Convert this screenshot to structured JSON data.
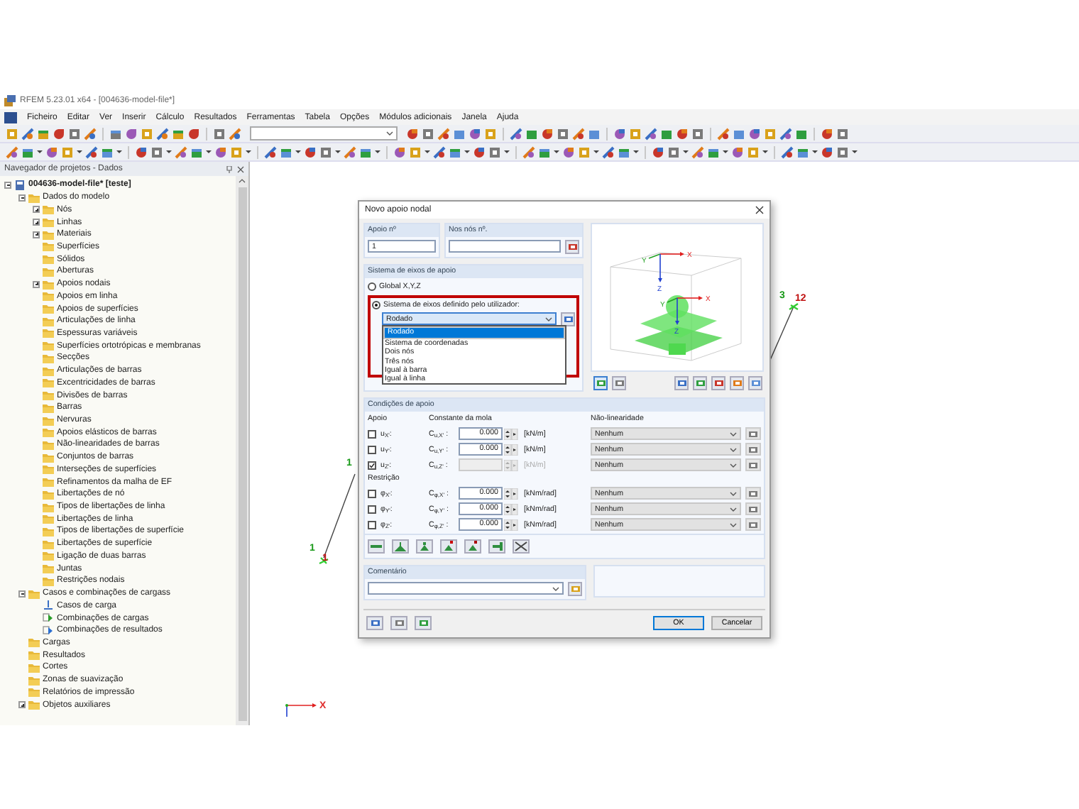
{
  "window": {
    "title": "RFEM 5.23.01 x64 - [004636-model-file*]"
  },
  "menu": [
    {
      "label": "Ficheiro"
    },
    {
      "label": "Editar"
    },
    {
      "label": "Ver"
    },
    {
      "label": "Inserir"
    },
    {
      "label": "Cálculo"
    },
    {
      "label": "Resultados"
    },
    {
      "label": "Ferramentas"
    },
    {
      "label": "Tabela"
    },
    {
      "label": "Opções"
    },
    {
      "label": "Módulos adicionais"
    },
    {
      "label": "Janela"
    },
    {
      "label": "Ajuda"
    }
  ],
  "navigator": {
    "title": "Navegador de projetos - Dados",
    "tree": [
      {
        "label": "004636-model-file* [teste]",
        "expanded": true,
        "children": [
          {
            "label": "Dados do modelo",
            "expanded": true,
            "children": [
              {
                "label": "Nós",
                "expanded": false
              },
              {
                "label": "Linhas",
                "expanded": false
              },
              {
                "label": "Materiais",
                "expanded": false
              },
              {
                "label": "Superfícies"
              },
              {
                "label": "Sólidos"
              },
              {
                "label": "Aberturas"
              },
              {
                "label": "Apoios nodais",
                "expanded": false
              },
              {
                "label": "Apoios em linha"
              },
              {
                "label": "Apoios de superfícies"
              },
              {
                "label": "Articulações de linha"
              },
              {
                "label": "Espessuras variáveis"
              },
              {
                "label": "Superfícies ortotrópicas e membranas"
              },
              {
                "label": "Secções"
              },
              {
                "label": "Articulações de barras"
              },
              {
                "label": "Excentricidades de barras"
              },
              {
                "label": "Divisões de barras"
              },
              {
                "label": "Barras"
              },
              {
                "label": "Nervuras"
              },
              {
                "label": "Apoios elásticos de barras"
              },
              {
                "label": "Não-linearidades de barras"
              },
              {
                "label": "Conjuntos de barras"
              },
              {
                "label": "Interseções de superfícies"
              },
              {
                "label": "Refinamentos da malha de EF"
              },
              {
                "label": "Libertações de nó"
              },
              {
                "label": "Tipos de libertações de linha"
              },
              {
                "label": "Libertações de linha"
              },
              {
                "label": "Tipos de libertações de superfície"
              },
              {
                "label": "Libertações de superfície"
              },
              {
                "label": "Ligação de duas barras"
              },
              {
                "label": "Juntas"
              },
              {
                "label": "Restrições nodais"
              }
            ]
          },
          {
            "label": "Casos e combinações de cargass",
            "expanded": true,
            "children": [
              {
                "label": "Casos de carga",
                "kind": "load-case"
              },
              {
                "label": "Combinações de cargas",
                "kind": "combination"
              },
              {
                "label": "Combinações de resultados",
                "kind": "result-combination"
              }
            ]
          },
          {
            "label": "Cargas"
          },
          {
            "label": "Resultados"
          },
          {
            "label": "Cortes"
          },
          {
            "label": "Zonas de suavização"
          },
          {
            "label": "Relatórios de impressão"
          },
          {
            "label": "Objetos auxiliares",
            "expanded": false
          }
        ]
      }
    ]
  },
  "canvas": {
    "labels": [
      {
        "text": "1",
        "color": "#1a9a1a"
      },
      {
        "text": "1",
        "color": "#1a9a1a"
      },
      {
        "text": "1",
        "color": "#c01010"
      },
      {
        "text": "3",
        "color": "#1a9a1a"
      },
      {
        "text": "12",
        "color": "#c01010"
      },
      {
        "text": "X",
        "color": "#e03030"
      }
    ]
  },
  "dialog": {
    "title": "Novo apoio nodal",
    "support_no": {
      "label": "Apoio nº",
      "value": "1"
    },
    "on_nodes": {
      "label": "Nos nós nº."
    },
    "axis_system": {
      "title": "Sistema de eixos de apoio",
      "options": [
        {
          "label": "Global X,Y,Z",
          "selected": false
        },
        {
          "label": "Sistema de eixos definido pelo utilizador:",
          "selected": true
        }
      ],
      "dropdown": {
        "value": "Rodado",
        "items": [
          {
            "label": "Rodado",
            "selected": true
          },
          {
            "label": "Sistema de coordenadas",
            "selected": false
          },
          {
            "label": "Dois nós",
            "selected": false
          },
          {
            "label": "Três nós",
            "selected": false
          },
          {
            "label": "Igual à barra",
            "selected": false
          },
          {
            "label": "Igual à linha",
            "selected": false
          }
        ]
      }
    },
    "preview": {
      "top_axes": [
        "Y",
        "X",
        "Z"
      ],
      "support_axes": [
        "Y",
        "X",
        "Z"
      ]
    },
    "conditions": {
      "title": "Condições de apoio",
      "col_support": "Apoio",
      "col_spring": "Constante da mola",
      "col_nonlinear": "Não-linearidade",
      "restraint_label": "Restrição",
      "support_rows": [
        {
          "name": "u$_{X'}$:",
          "constant": "C$_{u,X'}$ :",
          "checked": false,
          "value": "0.000",
          "unit": "[kN/m]",
          "nonlinearity": "Nenhum"
        },
        {
          "name": "u$_{Y'}$:",
          "constant": "C$_{u,Y'}$ :",
          "checked": false,
          "value": "0.000",
          "unit": "[kN/m]",
          "nonlinearity": "Nenhum"
        },
        {
          "name": "u$_{Z'}$:",
          "constant": "C$_{u,Z'}$ :",
          "checked": true,
          "unit": "[kN/m]",
          "nonlinearity": "Nenhum"
        }
      ],
      "restraint_rows": [
        {
          "name": "φ$_{X'}$:",
          "constant": "C$_{φ,X'}$ :",
          "checked": false,
          "value": "0.000",
          "unit": "[kNm/rad]",
          "nonlinearity": "Nenhum"
        },
        {
          "name": "φ$_{Y'}$:",
          "constant": "C$_{φ,Y'}$ :",
          "checked": false,
          "value": "0.000",
          "unit": "[kNm/rad]",
          "nonlinearity": "Nenhum"
        },
        {
          "name": "φ$_{Z'}$:",
          "constant": "C$_{φ,Z'}$ :",
          "checked": false,
          "value": "0.000",
          "unit": "[kNm/rad]",
          "nonlinearity": "Nenhum"
        }
      ]
    },
    "comment": {
      "label": "Comentário"
    },
    "buttons": [
      {
        "label": "OK",
        "kind": "default"
      },
      {
        "label": "Cancelar",
        "kind": "normal"
      }
    ]
  }
}
